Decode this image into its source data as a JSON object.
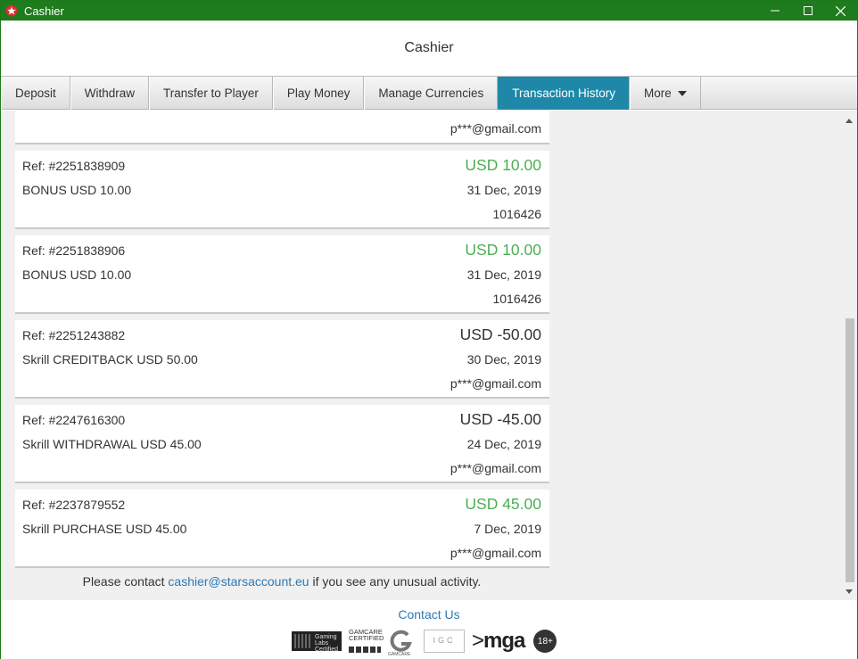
{
  "window": {
    "title": "Cashier",
    "controls": {
      "minimize": "minimize-icon",
      "maximize": "maximize-icon",
      "close": "close-icon"
    }
  },
  "header": {
    "title": "Cashier"
  },
  "tabs": [
    {
      "label": "Deposit",
      "active": false
    },
    {
      "label": "Withdraw",
      "active": false
    },
    {
      "label": "Transfer to Player",
      "active": false
    },
    {
      "label": "Play Money",
      "active": false
    },
    {
      "label": "Manage Currencies",
      "active": false
    },
    {
      "label": "Transaction History",
      "active": true
    },
    {
      "label": "More",
      "active": false
    }
  ],
  "transactions": {
    "partial": {
      "meta": "p***@gmail.com"
    },
    "items": [
      {
        "ref": "Ref: #2251838909",
        "description": "BONUS USD 10.00",
        "amount": "USD 10.00",
        "positive": true,
        "date": "31 Dec, 2019",
        "meta": "1016426"
      },
      {
        "ref": "Ref: #2251838906",
        "description": "BONUS USD 10.00",
        "amount": "USD 10.00",
        "positive": true,
        "date": "31 Dec, 2019",
        "meta": "1016426"
      },
      {
        "ref": "Ref: #2251243882",
        "description": "Skrill CREDITBACK USD 50.00",
        "amount": "USD -50.00",
        "positive": false,
        "date": "30 Dec, 2019",
        "meta": "p***@gmail.com"
      },
      {
        "ref": "Ref: #2247616300",
        "description": "Skrill WITHDRAWAL USD 45.00",
        "amount": "USD -45.00",
        "positive": false,
        "date": "24 Dec, 2019",
        "meta": "p***@gmail.com"
      },
      {
        "ref": "Ref: #2237879552",
        "description": "Skrill PURCHASE USD 45.00",
        "amount": "USD 45.00",
        "positive": true,
        "date": "7 Dec, 2019",
        "meta": "p***@gmail.com"
      }
    ]
  },
  "notice": {
    "prefix": "Please contact ",
    "email": "cashier@starsaccount.eu",
    "suffix": " if you see any unusual activity."
  },
  "footer": {
    "contact_us": "Contact Us",
    "logos": {
      "gaming_labs": "Gaming Labs Certified",
      "gamcare_top": "GAMCARE",
      "gamcare_mid": "CERTIFIED",
      "gamcare_small": "GAMCARE",
      "igc": "IGC",
      "mga": "mga",
      "age": "18+"
    }
  },
  "colors": {
    "title_bar": "#1e7b1e",
    "active_tab": "#1f88a8",
    "positive_amount": "#4caf50",
    "link": "#2f79b4"
  }
}
